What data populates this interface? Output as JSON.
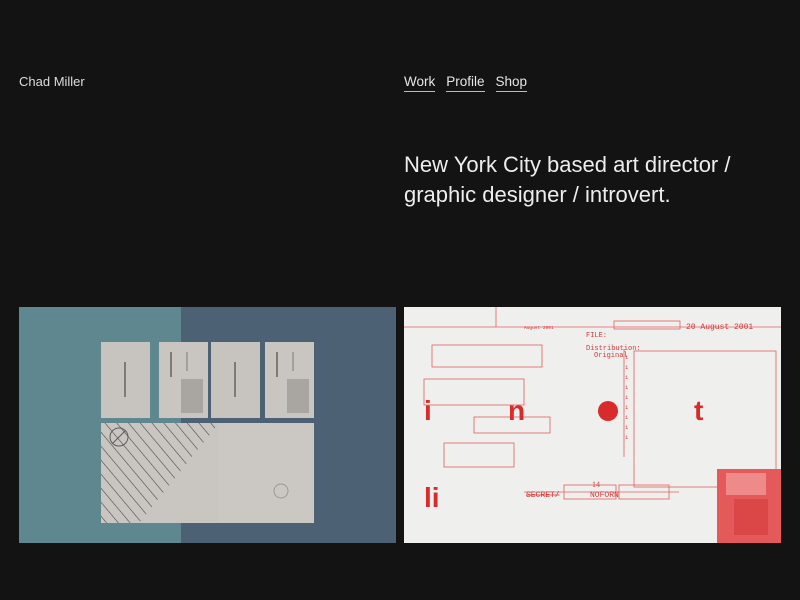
{
  "header": {
    "site_name": "Chad Miller",
    "nav": [
      {
        "label": "Work"
      },
      {
        "label": "Profile"
      },
      {
        "label": "Shop"
      }
    ]
  },
  "intro": {
    "tagline": "New York City based art director / graphic designer / introvert."
  },
  "colors": {
    "background": "#131313",
    "panel_teal": "#5f8790",
    "panel_slate": "#4d6175",
    "paper": "#efefed",
    "accent_red": "#d92b2b"
  },
  "projects": [
    {
      "name": "stationery-mockup"
    },
    {
      "name": "inot-document-poster",
      "letters": [
        "i",
        "n",
        "t",
        "li"
      ],
      "doc_date": "20 August 2001",
      "doc_file": "FILE:",
      "doc_distribution": "Distribution:",
      "doc_original": "Original",
      "doc_number": "14",
      "doc_secret": "SECRET/",
      "doc_noforn": "NOFORN",
      "doc_date_small": "August 2001"
    }
  ]
}
